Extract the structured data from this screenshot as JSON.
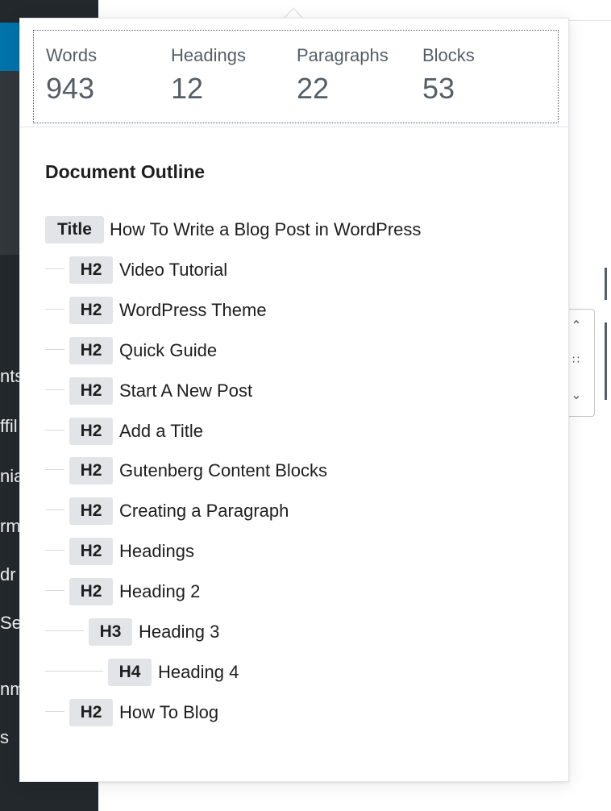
{
  "sidebar_fragments": [
    "nts",
    "ffil",
    "nia",
    "rm",
    "dr .",
    "Se",
    "nm",
    "s"
  ],
  "block_toolbar": {
    "move_up_icon": "chevron-up-icon",
    "drag_icon": "drag-handle-icon",
    "move_down_icon": "chevron-down-icon"
  },
  "counts": [
    {
      "label": "Words",
      "value": "943"
    },
    {
      "label": "Headings",
      "value": "12"
    },
    {
      "label": "Paragraphs",
      "value": "22"
    },
    {
      "label": "Blocks",
      "value": "53"
    }
  ],
  "outline": {
    "title": "Document Outline",
    "items": [
      {
        "level": "Title",
        "text": "How To Write a Blog Post in WordPress"
      },
      {
        "level": "H2",
        "text": "Video Tutorial"
      },
      {
        "level": "H2",
        "text": "WordPress Theme"
      },
      {
        "level": "H2",
        "text": "Quick Guide"
      },
      {
        "level": "H2",
        "text": "Start A New Post"
      },
      {
        "level": "H2",
        "text": "Add a Title"
      },
      {
        "level": "H2",
        "text": "Gutenberg Content Blocks"
      },
      {
        "level": "H2",
        "text": "Creating a Paragraph"
      },
      {
        "level": "H2",
        "text": "Headings"
      },
      {
        "level": "H2",
        "text": "Heading 2"
      },
      {
        "level": "H3",
        "text": "Heading 3"
      },
      {
        "level": "H4",
        "text": "Heading 4"
      },
      {
        "level": "H2",
        "text": "How To Blog"
      }
    ]
  },
  "colors": {
    "sidebar": "#23282d",
    "sidebar_active": "#0073aa",
    "badge_bg": "#e2e4e7",
    "muted_text": "#555d66"
  }
}
